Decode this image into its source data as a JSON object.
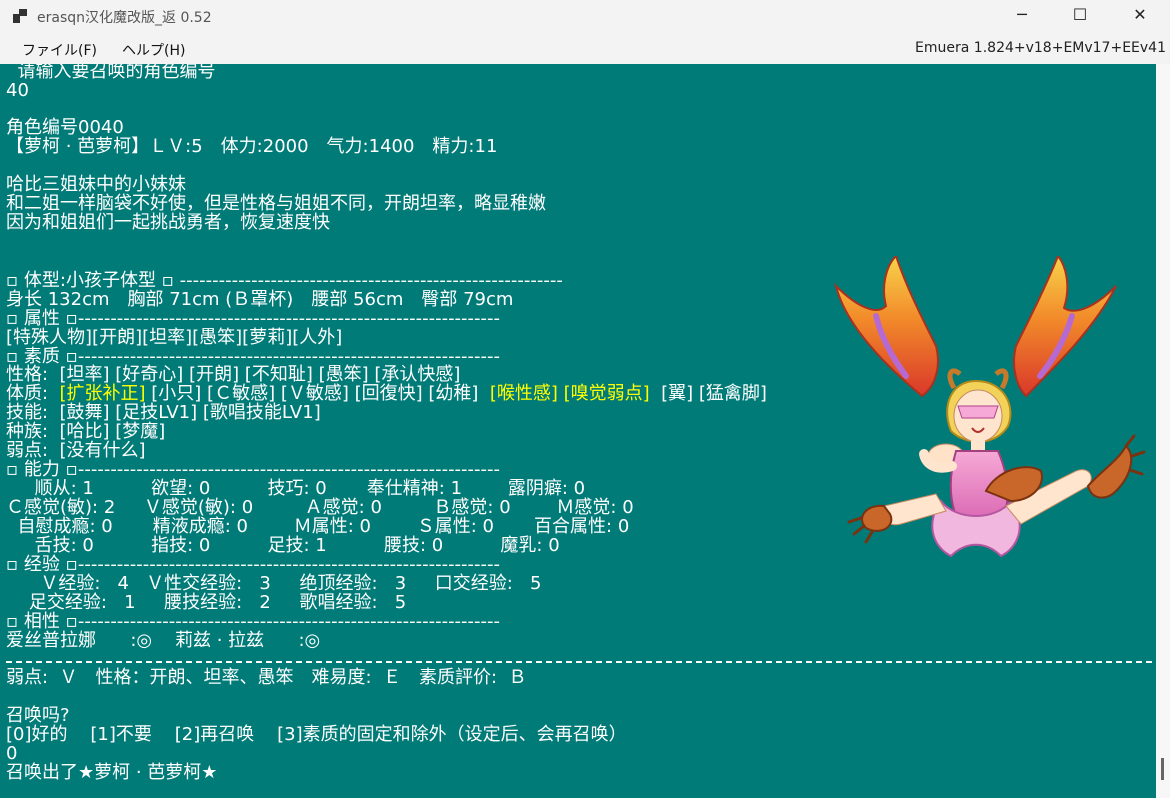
{
  "window": {
    "title": "erasqn汉化魔改版_返 0.52",
    "minimize": "─",
    "maximize": "☐",
    "close": "✕"
  },
  "menu": {
    "file": "ファイル(F)",
    "help": "ヘルプ(H)",
    "version": "Emuera 1.824+v18+EMv17+EEv41"
  },
  "console": {
    "l01": "  请输入要召唤的角色编号",
    "l02": "40",
    "l03": "角色编号0040",
    "l04": "【萝柯 · 芭萝柯】ＬＶ:5　体力:2000　气力:1400　精力:11",
    "l05": "哈比三姐妹中的小妹妹",
    "l06": "和二姐一样脑袋不好使，但是性格与姐姐不同，开朗坦率，略显稚嫩",
    "l07": "因为和姐姐们一起挑战勇者，恢复速度快",
    "l08": "▫ 体型:小孩子体型 ▫ -----------------------------------------------------------",
    "l09": "身长 132cm　胸部 71cm (Ｂ罩杯)　腰部 56cm　臀部 79cm",
    "l10": "▫ 属性 ▫-----------------------------------------------------------------",
    "l11": "[特殊人物][开朗][坦率][愚笨][萝莉][人外]",
    "l12": "▫ 素质 ▫-----------------------------------------------------------------",
    "l13": "性格:  [坦率] [好奇心] [开朗] [不知耻] [愚笨] [承认快感]",
    "l14a": "体质:  ",
    "l14b": "[扩张补正]",
    "l14c": " [小只] [Ｃ敏感] [Ｖ敏感] [回復快] [幼稚]  ",
    "l14d": "[喉性感] [嗅觉弱点]",
    "l14e": "  [翼] [猛禽脚]",
    "l15": "技能:  [鼓舞] [足技LV1] [歌唱技能LV1]",
    "l16": "种族:  [哈比] [梦魔]",
    "l17": "弱点:  [没有什么]",
    "l18": "▫ 能力 ▫-----------------------------------------------------------------",
    "l19": "     顺从: 1          欲望: 0          技巧: 0       奉仕精神: 1        露阴癖: 0",
    "l20": "Ｃ感觉(敏): 2     Ｖ感觉(敏): 0         Ａ感觉: 0         Ｂ感觉: 0        Ｍ感觉: 0",
    "l21": "  自慰成瘾: 0       精液成瘾: 0        Ｍ属性: 0        Ｓ属性: 0       百合属性: 0",
    "l22": "     舌技: 0          指技: 0          足技: 1          腰技: 0          魔乳: 0",
    "l23": "▫ 经验 ▫-----------------------------------------------------------------",
    "l24": "      Ｖ经验:   4   Ｖ性交经验:   3     绝顶经验:   3     口交经验:   5",
    "l25": "    足交经验:   1     腰技经验:   2     歌唱经验:   5",
    "l26": "▫ 相性 ▫-----------------------------------------------------------------",
    "l27": "爱丝普拉娜      :◎    莉兹 · 拉兹      :◎",
    "l28": "弱点:  Ｖ　性格：开朗、坦率、愚笨　难易度:  Ｅ　素质評价:  Ｂ",
    "l29": "召唤吗?",
    "l30": "[0]好的    [1]不要    [2]再召唤    [3]素质的固定和除外（设定后、会再召唤）",
    "l31": "0",
    "l32": "召唤出了★萝柯 · 芭萝柯★"
  },
  "colors": {
    "console_bg": "#007b78",
    "text": "#ffffff",
    "highlight": "#ffff00"
  },
  "icons": {
    "app": "window-app-icon",
    "portrait": "harpy-girl-portrait"
  }
}
